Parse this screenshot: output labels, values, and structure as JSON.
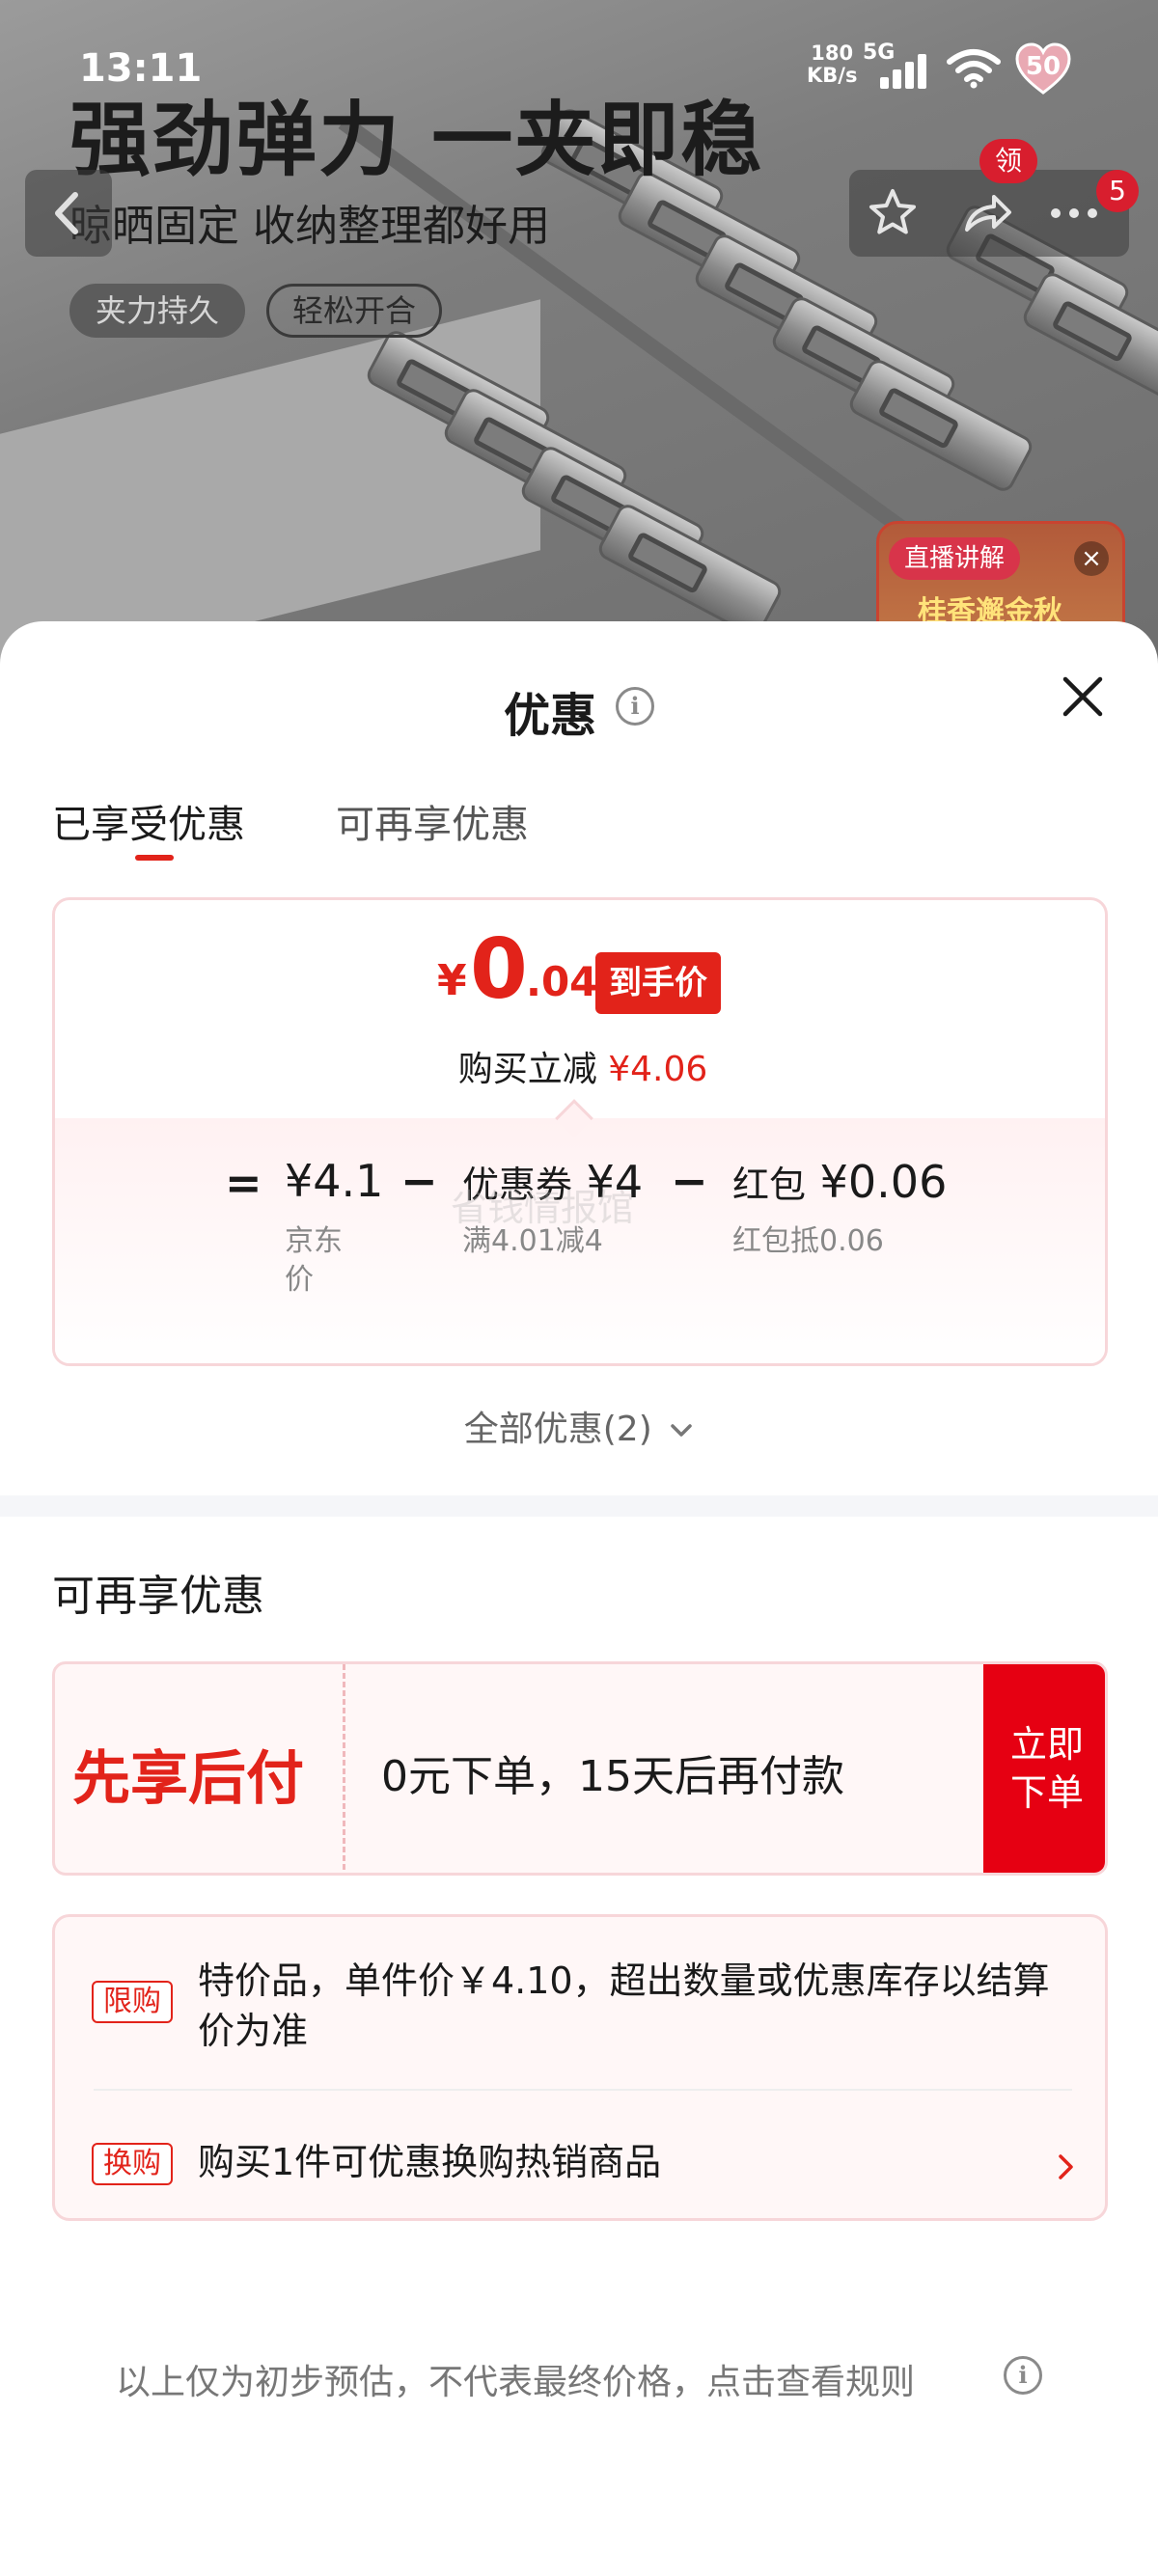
{
  "status_bar": {
    "time": "13:11",
    "net_speed_value": "180",
    "net_speed_unit": "KB/s",
    "network_type": "5G",
    "battery": "50"
  },
  "hero": {
    "title": "强劲弹力 一夹即稳",
    "subtitle": "晾晒固定 收纳整理都好用",
    "tags": [
      "夹力持久",
      "轻松开合"
    ],
    "coupon_badge": "领",
    "cart_count": "5",
    "live_label": "直播讲解",
    "live_text": "桂香邂金秋"
  },
  "sheet": {
    "title": "优惠",
    "tabs": [
      {
        "label": "已享受优惠",
        "active": true
      },
      {
        "label": "可再享优惠",
        "active": false
      }
    ],
    "price_card": {
      "currency": "¥",
      "price_int": "0",
      "price_dec": ".04",
      "final_badge": "到手价",
      "reduce_label": "购买立减",
      "reduce_amount": "¥4.06",
      "breakdown": {
        "equals": "=",
        "jd_price": "¥4.1",
        "jd_label_line1": "京东",
        "jd_label_line2": "价",
        "minus": "−",
        "coupon_title": "优惠券",
        "coupon_amount": "¥4",
        "coupon_desc": "满4.01减4",
        "redpacket_title": "红包",
        "redpacket_amount": "¥0.06",
        "redpacket_desc": "红包抵0.06"
      },
      "watermark": "省钱情报馆"
    },
    "all_offers_label": "全部优惠(2)",
    "more_section_title": "可再享优惠",
    "pay_later": {
      "brand": "先享后付",
      "description": "0元下单，15天后再付款",
      "button_line1": "立即",
      "button_line2": "下单"
    },
    "rules": [
      {
        "tag": "限购",
        "line1": "特价品，单件价￥4.10，超出数量或优惠库存以结算",
        "line2": "价为准"
      },
      {
        "tag": "换购",
        "line1": "购买1件可优惠换购热销商品",
        "line2": ""
      }
    ],
    "footer_note": "以上仅为初步预估，不代表最终价格，点击查看规则"
  },
  "colors": {
    "accent_red": "#e2231a",
    "button_red": "#e60012",
    "card_border": "#f7d6d9",
    "card_bg": "#fff7f7"
  },
  "icons": [
    "back-icon",
    "star-icon",
    "share-icon",
    "more-icon",
    "info-icon",
    "close-icon",
    "chevron-down-icon",
    "chevron-right-icon"
  ]
}
